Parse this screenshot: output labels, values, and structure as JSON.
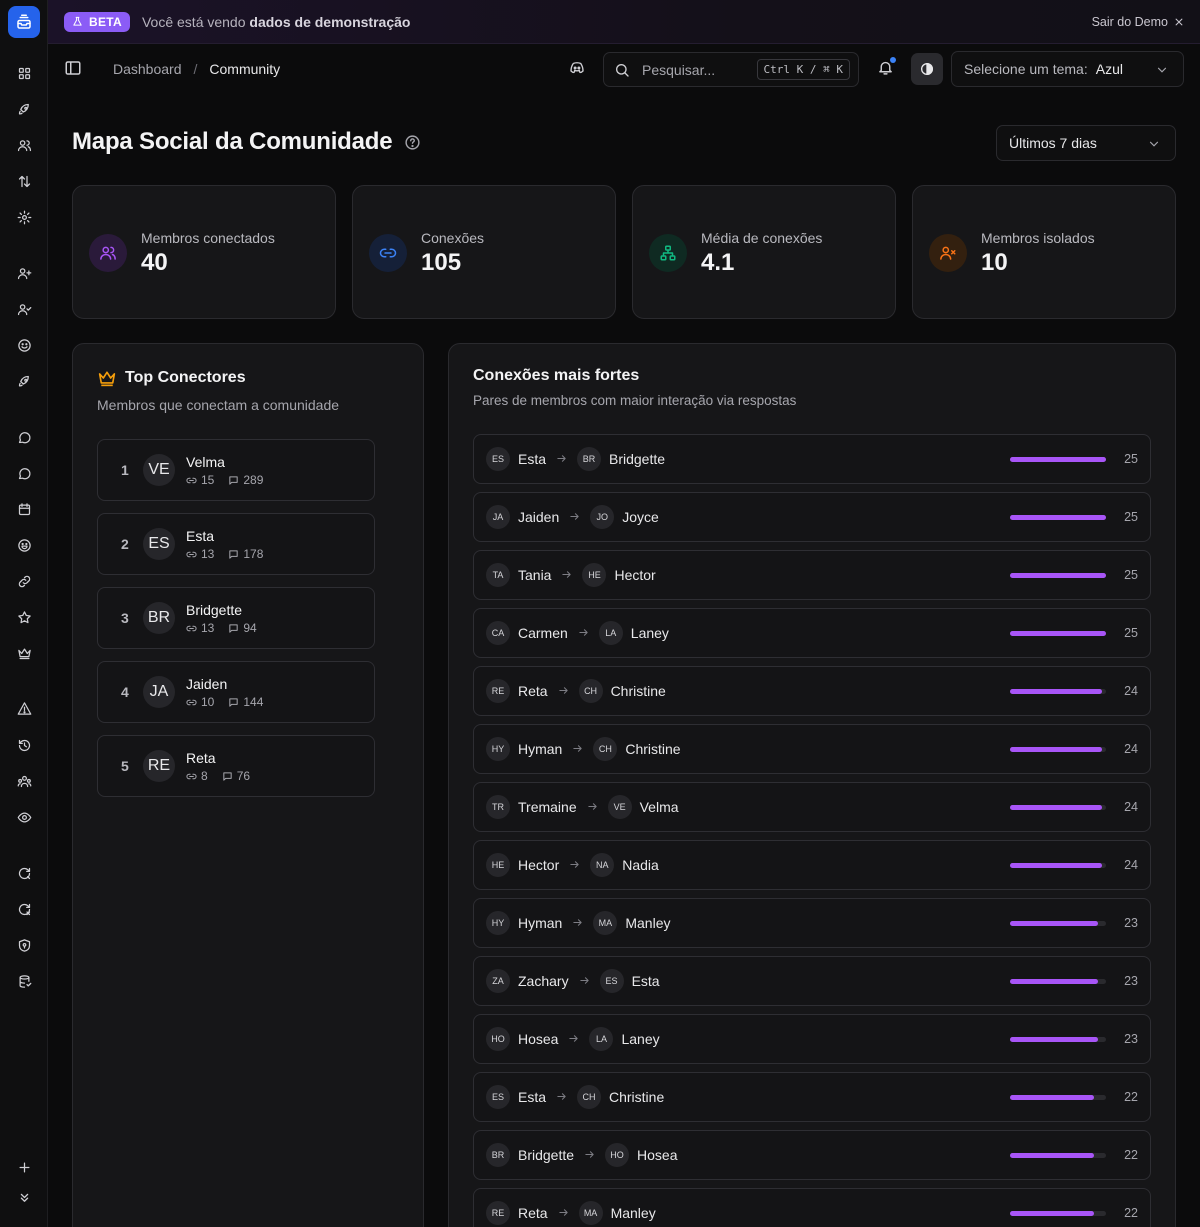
{
  "banner": {
    "badge": "BETA",
    "text_prefix": "Você está vendo",
    "text_bold": "dados de demonstração",
    "exit": "Sair do Demo"
  },
  "breadcrumb": {
    "root": "Dashboard",
    "separator": "/",
    "current": "Community"
  },
  "search": {
    "placeholder": "Pesquisar...",
    "shortcut": "Ctrl K / ⌘ K"
  },
  "theme": {
    "label": "Selecione um tema:",
    "value": "Azul"
  },
  "page": {
    "title": "Mapa Social da Comunidade",
    "range": "Últimos 7 dias"
  },
  "colors": {
    "accent": "#2563eb",
    "bar": "#a855f7",
    "notification": "#3b82f6"
  },
  "stats": [
    {
      "label": "Membros conectados",
      "value": "40",
      "icon": "users-icon",
      "color": "#a855f7"
    },
    {
      "label": "Conexões",
      "value": "105",
      "icon": "link-icon",
      "color": "#3b82f6"
    },
    {
      "label": "Média de conexões",
      "value": "4.1",
      "icon": "network-icon",
      "color": "#10b981"
    },
    {
      "label": "Membros isolados",
      "value": "10",
      "icon": "user-x-icon",
      "color": "#f97316"
    }
  ],
  "top_connectors": {
    "title": "Top Conectores",
    "subtitle": "Membros que conectam a comunidade",
    "items": [
      {
        "rank": "1",
        "initials": "VE",
        "name": "Velma",
        "connections": "15",
        "replies": "289"
      },
      {
        "rank": "2",
        "initials": "ES",
        "name": "Esta",
        "connections": "13",
        "replies": "178"
      },
      {
        "rank": "3",
        "initials": "BR",
        "name": "Bridgette",
        "connections": "13",
        "replies": "94"
      },
      {
        "rank": "4",
        "initials": "JA",
        "name": "Jaiden",
        "connections": "10",
        "replies": "144"
      },
      {
        "rank": "5",
        "initials": "RE",
        "name": "Reta",
        "connections": "8",
        "replies": "76"
      }
    ]
  },
  "strong_connections": {
    "title": "Conexões mais fortes",
    "subtitle": "Pares de membros com maior interação via respostas",
    "max": 25,
    "pairs": [
      {
        "from_initials": "ES",
        "from": "Esta",
        "to_initials": "BR",
        "to": "Bridgette",
        "value": 25
      },
      {
        "from_initials": "JA",
        "from": "Jaiden",
        "to_initials": "JO",
        "to": "Joyce",
        "value": 25
      },
      {
        "from_initials": "TA",
        "from": "Tania",
        "to_initials": "HE",
        "to": "Hector",
        "value": 25
      },
      {
        "from_initials": "CA",
        "from": "Carmen",
        "to_initials": "LA",
        "to": "Laney",
        "value": 25
      },
      {
        "from_initials": "RE",
        "from": "Reta",
        "to_initials": "CH",
        "to": "Christine",
        "value": 24
      },
      {
        "from_initials": "HY",
        "from": "Hyman",
        "to_initials": "CH",
        "to": "Christine",
        "value": 24
      },
      {
        "from_initials": "TR",
        "from": "Tremaine",
        "to_initials": "VE",
        "to": "Velma",
        "value": 24
      },
      {
        "from_initials": "HE",
        "from": "Hector",
        "to_initials": "NA",
        "to": "Nadia",
        "value": 24
      },
      {
        "from_initials": "HY",
        "from": "Hyman",
        "to_initials": "MA",
        "to": "Manley",
        "value": 23
      },
      {
        "from_initials": "ZA",
        "from": "Zachary",
        "to_initials": "ES",
        "to": "Esta",
        "value": 23
      },
      {
        "from_initials": "HO",
        "from": "Hosea",
        "to_initials": "LA",
        "to": "Laney",
        "value": 23
      },
      {
        "from_initials": "ES",
        "from": "Esta",
        "to_initials": "CH",
        "to": "Christine",
        "value": 22
      },
      {
        "from_initials": "BR",
        "from": "Bridgette",
        "to_initials": "HO",
        "to": "Hosea",
        "value": 22
      },
      {
        "from_initials": "RE",
        "from": "Reta",
        "to_initials": "MA",
        "to": "Manley",
        "value": 22
      }
    ]
  },
  "sidebar": {
    "icons": [
      "dashboard-icon",
      "rocket-icon",
      "users-icon",
      "sort-icon",
      "settings-icon",
      "user-plus-icon",
      "user-check-icon",
      "smile-icon",
      "rocket-alt-icon",
      "message-icon",
      "message-alt-icon",
      "calendar-icon",
      "emoji-icon",
      "link-icon",
      "star-icon",
      "crown-icon",
      "warning-icon",
      "history-icon",
      "team-icon",
      "eye-icon",
      "refresh-icon",
      "refresh-x-icon",
      "shield-icon",
      "database-icon",
      "plus-icon",
      "chevrons-down-icon"
    ]
  }
}
